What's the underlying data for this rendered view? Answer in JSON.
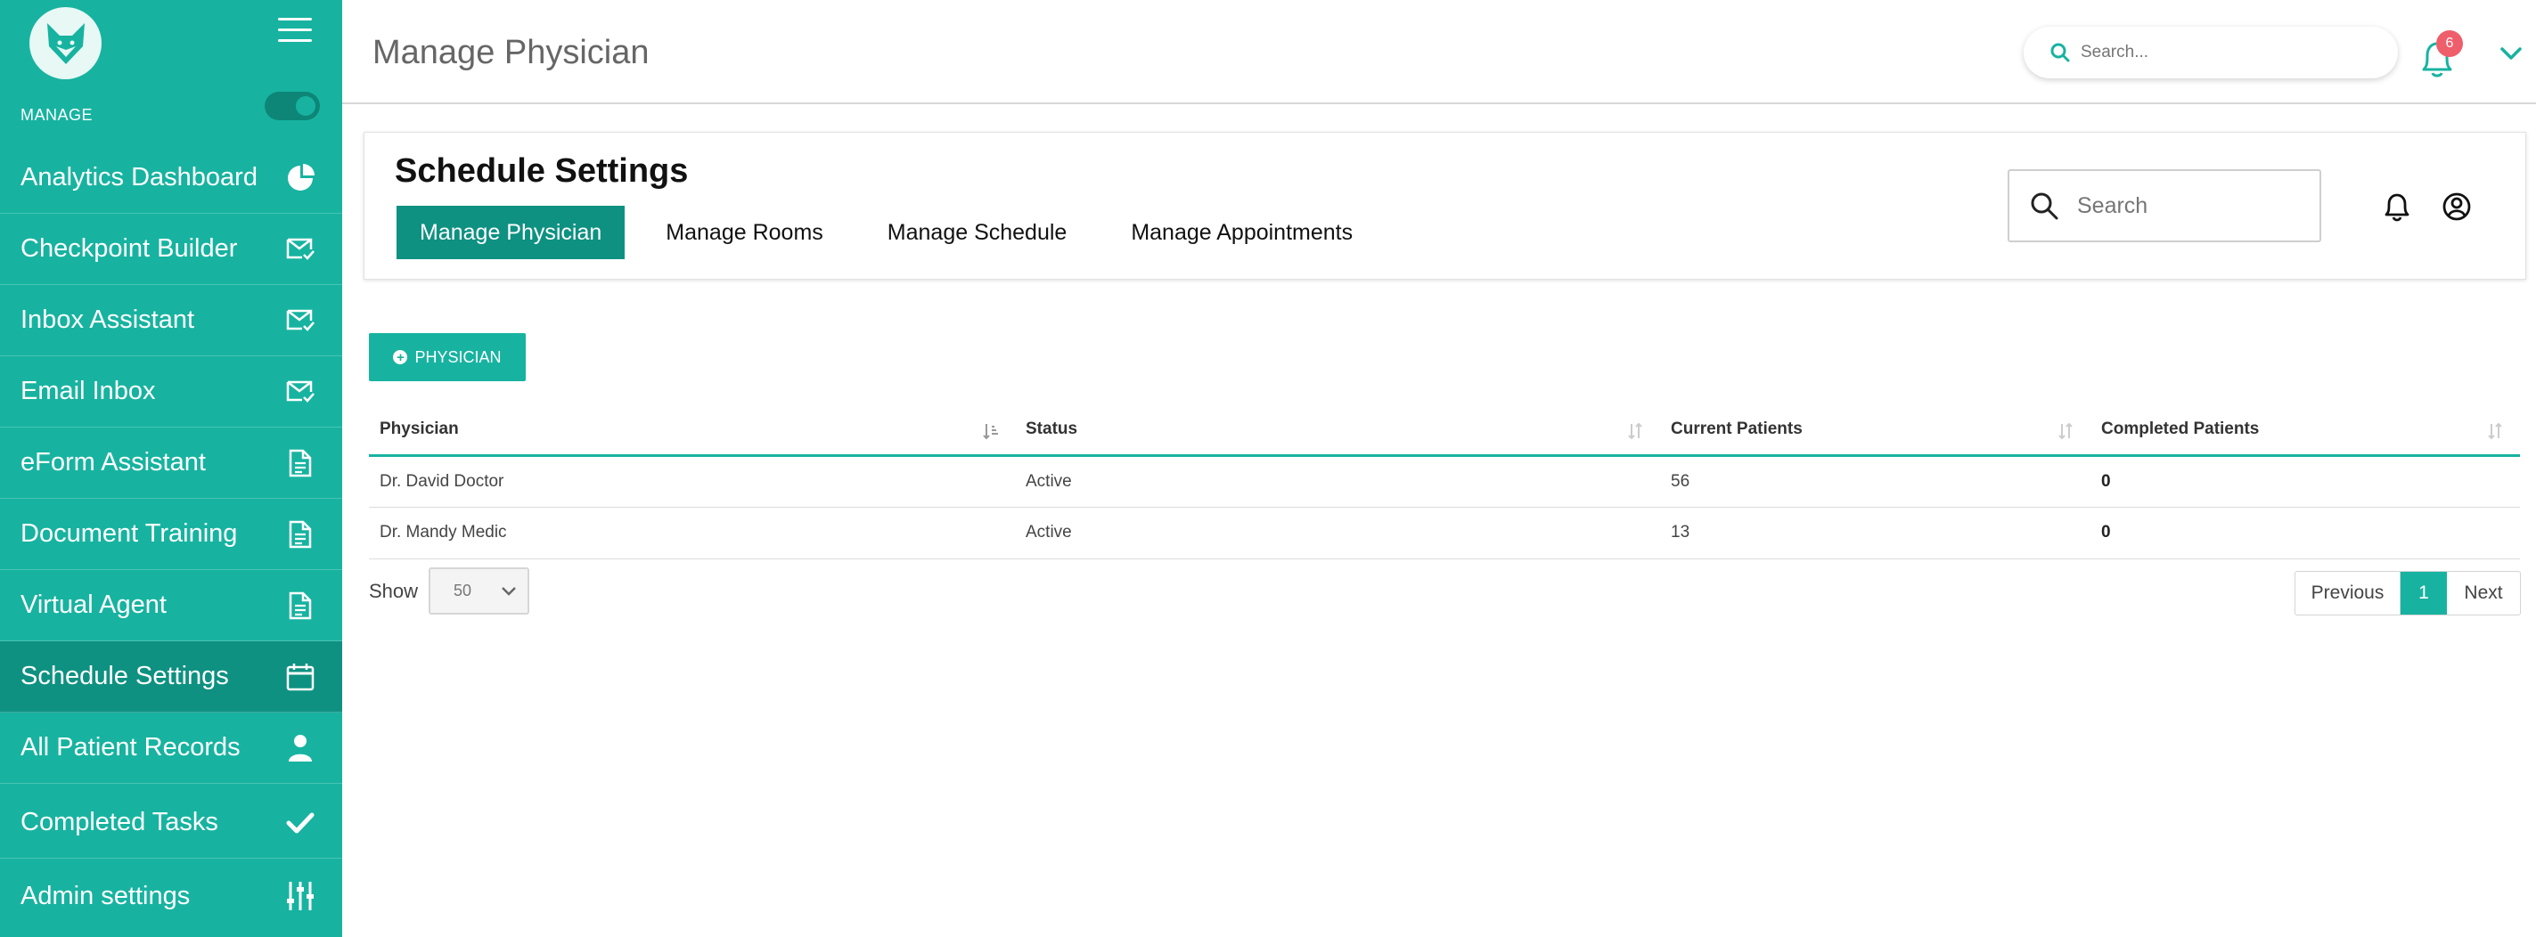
{
  "sidebar": {
    "section_label": "MANAGE",
    "items": [
      {
        "label": "Analytics Dashboard",
        "icon": "pie-chart-icon"
      },
      {
        "label": "Checkpoint Builder",
        "icon": "mail-check-icon"
      },
      {
        "label": "Inbox Assistant",
        "icon": "mail-check-icon"
      },
      {
        "label": "Email Inbox",
        "icon": "mail-check-icon"
      },
      {
        "label": "eForm Assistant",
        "icon": "document-icon"
      },
      {
        "label": "Document Training",
        "icon": "document-icon"
      },
      {
        "label": "Virtual Agent",
        "icon": "document-icon"
      },
      {
        "label": "Schedule Settings",
        "icon": "calendar-icon",
        "active": true
      },
      {
        "label": "All Patient Records",
        "icon": "user-icon"
      },
      {
        "label": "Completed Tasks",
        "icon": "checkmark-icon"
      },
      {
        "label": "Admin settings",
        "icon": "sliders-icon"
      }
    ]
  },
  "header": {
    "title": "Manage Physician",
    "search_placeholder": "Search...",
    "notification_count": "6"
  },
  "card": {
    "title": "Schedule Settings",
    "tabs": [
      {
        "label": "Manage Physician",
        "active": true
      },
      {
        "label": "Manage Rooms"
      },
      {
        "label": "Manage Schedule"
      },
      {
        "label": "Manage Appointments"
      }
    ],
    "search_placeholder": "Search"
  },
  "main": {
    "add_button_label": "PHYSICIAN",
    "table": {
      "columns": [
        "Physician",
        "Status",
        "Current Patients",
        "Completed Patients"
      ],
      "rows": [
        [
          "Dr. David Doctor",
          "Active",
          "56",
          "0"
        ],
        [
          "Dr. Mandy Medic",
          "Active",
          "13",
          "0"
        ]
      ]
    },
    "show_label": "Show",
    "page_size": "50",
    "pagination": {
      "previous": "Previous",
      "current": "1",
      "next": "Next"
    }
  },
  "colors": {
    "accent": "#17b3a0",
    "accent_dark": "#0e9181",
    "badge": "#ef5e6b"
  }
}
